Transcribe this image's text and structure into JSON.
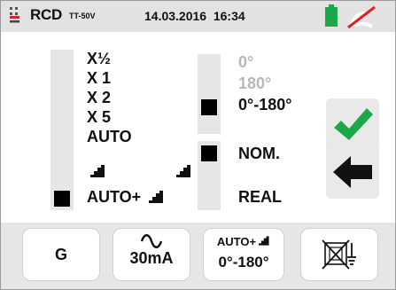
{
  "header": {
    "mode_label": "RCD",
    "system_label": "TT-50V",
    "date": "14.03.2016",
    "time": "16:34",
    "battery_icon": "battery-full-icon",
    "wireless_icon": "wireless-disabled-icon"
  },
  "multiplier": {
    "options": [
      "X½",
      "X 1",
      "X 2",
      "X 5",
      "AUTO",
      "AUTO+"
    ],
    "selected": "AUTO+"
  },
  "phase": {
    "options": [
      "0°",
      "180°",
      "0°-180°"
    ],
    "selected": "0°-180°",
    "disabled_options": [
      "0°",
      "180°"
    ]
  },
  "current_type": {
    "options": [
      "NOM.",
      "REAL"
    ],
    "selected": "NOM."
  },
  "side_buttons": {
    "confirm_icon": "checkmark-icon",
    "back_icon": "back-arrow-icon"
  },
  "footer": {
    "type_button": "G",
    "current_button": "30mA",
    "current_icon": "ac-wave-icon",
    "mode_button_line1": "AUTO+",
    "mode_button_line2": "0°-180°",
    "earth_button_icon": "no-earth-icon"
  },
  "colors": {
    "header_bg": "#e2e2e2",
    "battery": "#1aa84a",
    "check": "#1aa84a",
    "wireless_strike": "#e02020",
    "selector_strip": "#e6e6e6",
    "footer_bg": "#e6e6e6"
  }
}
